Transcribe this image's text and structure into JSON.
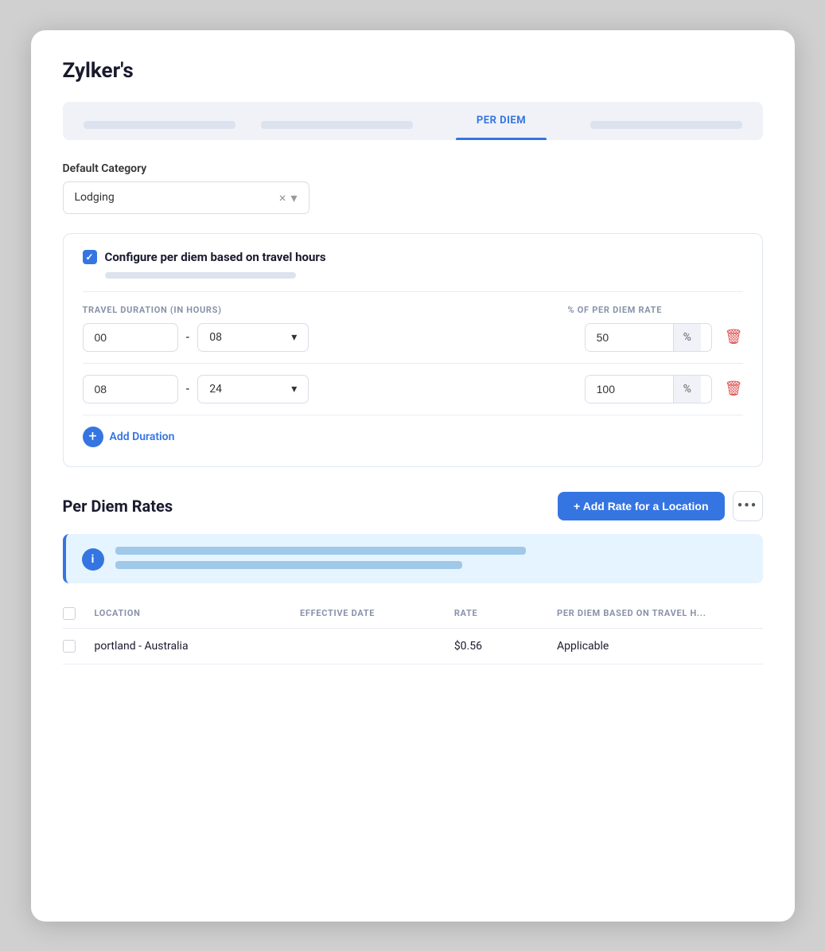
{
  "app": {
    "title": "Zylker's"
  },
  "tabs": [
    {
      "id": "tab1",
      "label": "",
      "active": false
    },
    {
      "id": "tab2",
      "label": "",
      "active": false
    },
    {
      "id": "per-diem",
      "label": "PER DIEM",
      "active": true
    },
    {
      "id": "tab4",
      "label": "",
      "active": false
    }
  ],
  "default_category": {
    "label": "Default Category",
    "value": "Lodging",
    "clear_icon": "×",
    "dropdown_icon": "▾"
  },
  "configure_section": {
    "checkbox_checked": true,
    "title": "Configure per diem based on travel hours",
    "col_header_left": "TRAVEL DURATION (IN HOURS)",
    "col_header_right": "% OF PER DIEM RATE",
    "rows": [
      {
        "from": "00",
        "to": "08",
        "rate": "50",
        "percent": "%"
      },
      {
        "from": "08",
        "to": "24",
        "rate": "100",
        "percent": "%"
      }
    ],
    "add_duration_label": "Add Duration"
  },
  "per_diem_rates": {
    "title": "Per Diem Rates",
    "add_btn_label": "+ Add Rate for a Location",
    "more_btn_label": "•••",
    "info_line1_width": "65%",
    "info_line2_width": "55%",
    "table": {
      "col_location": "LOCATION",
      "col_date": "EFFECTIVE DATE",
      "col_rate": "RATE",
      "col_perdiem": "PER DIEM BASED ON TRAVEL H...",
      "rows": [
        {
          "location": "portland - Australia",
          "date": "",
          "rate": "$0.56",
          "perdiem": "Applicable"
        }
      ]
    }
  }
}
